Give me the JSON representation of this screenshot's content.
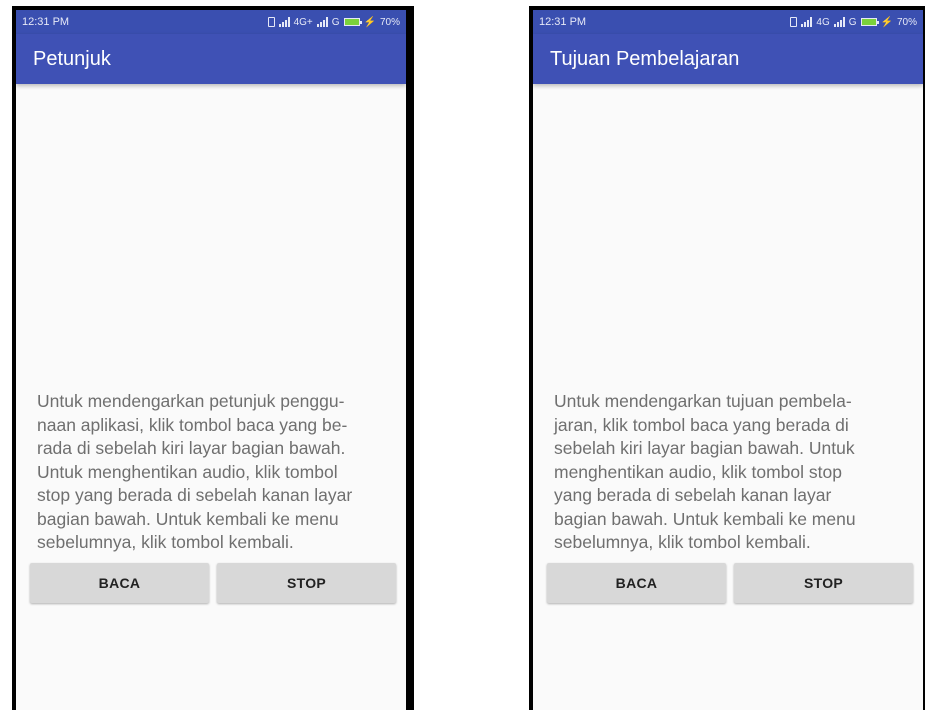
{
  "screens": [
    {
      "status": {
        "time": "12:31 PM",
        "network": "4G+",
        "network2": "G",
        "battery": "70%"
      },
      "title": "Petunjuk",
      "body": "Untuk mendengarkan petunjuk penggu-\nnaan aplikasi, klik tombol baca yang be-\nrada di sebelah kiri layar bagian bawah.\nUntuk menghentikan audio, klik tombol\nstop yang berada di sebelah kanan layar\nbagian bawah. Untuk kembali ke menu\nsebelumnya, klik tombol kembali.",
      "buttons": {
        "read": "BACA",
        "stop": "STOP"
      }
    },
    {
      "status": {
        "time": "12:31 PM",
        "network": "4G",
        "network2": "G",
        "battery": "70%"
      },
      "title": "Tujuan Pembelajaran",
      "body": "Untuk mendengarkan tujuan pembela-\njaran, klik tombol baca yang berada di\nsebelah kiri layar bagian bawah. Untuk\nmenghentikan audio, klik tombol stop\nyang berada di sebelah kanan layar\nbagian bawah. Untuk kembali ke menu\nsebelumnya, klik tombol kembali.",
      "buttons": {
        "read": "BACA",
        "stop": "STOP"
      }
    }
  ],
  "colors": {
    "appbar": "#3f51b5",
    "statusbar": "#3a4fb0",
    "button": "#d8d8d8",
    "text": "#6f6f6f"
  }
}
